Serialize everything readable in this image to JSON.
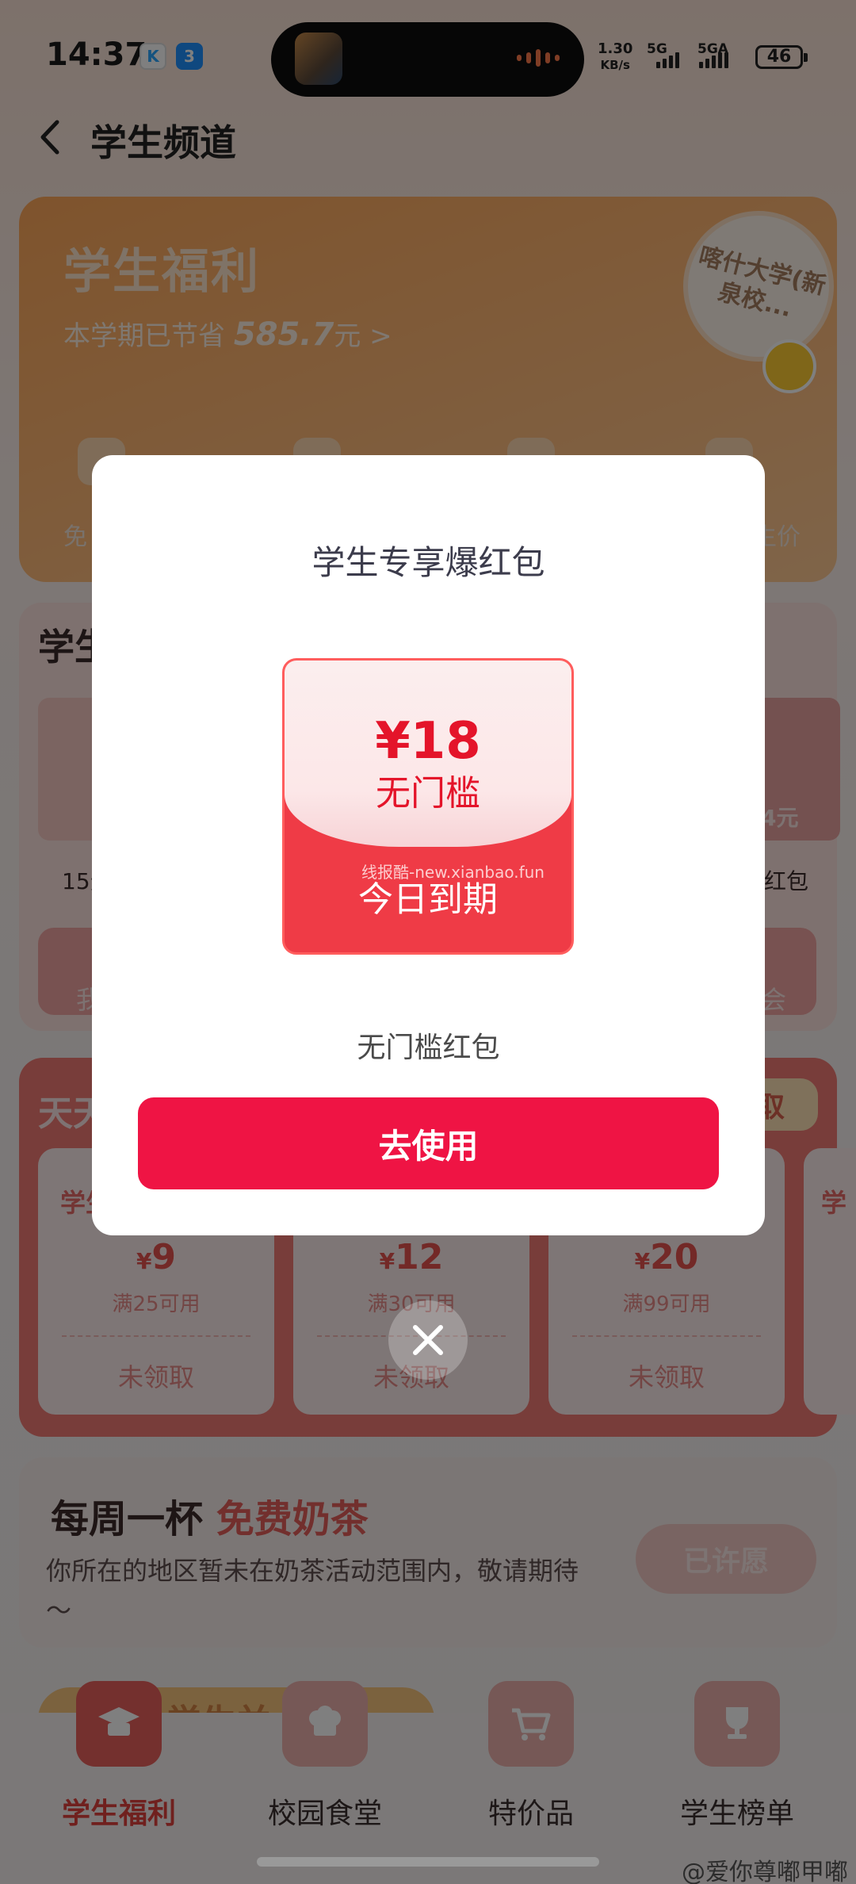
{
  "status_bar": {
    "time": "14:37",
    "app_icon_1": "K",
    "app_icon_2": "3",
    "speed_value": "1.30",
    "speed_unit": "KB/s",
    "network_1": "5G",
    "network_2": "5GA",
    "battery": "46"
  },
  "header": {
    "back_icon": "chevron-left-icon",
    "title": "学生频道"
  },
  "hero": {
    "title": "学生福利",
    "savings_prefix": "本学期已节省",
    "savings_amount": "585.7",
    "savings_unit": "元",
    "arrow": ">",
    "school_tag": "喀什大学(新泉校...",
    "shortcut_left_label": "免",
    "shortcut_right_label": "生价"
  },
  "section2": {
    "title": "学生",
    "left_label": "15元",
    "right_label": "红包",
    "bar_left": "我",
    "bar_right": "会",
    "card_right_amount": "4元"
  },
  "daily": {
    "title": "天天",
    "get_button": "取",
    "coupons": [
      {
        "header": "学生",
        "value": "9",
        "condition": "满25可用",
        "status": "未领取"
      },
      {
        "header": "",
        "value": "12",
        "condition": "满30可用",
        "status": "未领取"
      },
      {
        "header": "",
        "value": "20",
        "condition": "满99可用",
        "status": "未领取"
      }
    ],
    "currency": "¥",
    "edge_label": "学"
  },
  "milk_tea": {
    "title_part1": "每周一杯",
    "title_part2": "免费奶茶",
    "description": "你所在的地区暂未在奶茶活动范围内，敬请期待～",
    "button": "已许愿"
  },
  "banner": {
    "text": "学生并"
  },
  "tabbar": {
    "items": [
      {
        "label": "学生福利",
        "icon": "student-hat-icon",
        "active": true
      },
      {
        "label": "校园食堂",
        "icon": "chef-hat-icon",
        "active": false
      },
      {
        "label": "特价品",
        "icon": "cart-icon",
        "active": false
      },
      {
        "label": "学生榜单",
        "icon": "trophy-icon",
        "active": false
      }
    ]
  },
  "watermark": "@爱你尊嘟甲嘟",
  "modal": {
    "title": "学生专享爆红包",
    "currency": "¥",
    "amount": "18",
    "threshold": "无门槛",
    "expiry": "今日到期",
    "site_watermark": "线报酷-new.xianbao.fun",
    "packet_name": "无门槛红包",
    "use_button": "去使用",
    "close_icon": "close-icon"
  },
  "colors": {
    "accent_red": "#ef1444",
    "hero_orange": "#ffa85a",
    "coupon_red": "#e6534f"
  }
}
